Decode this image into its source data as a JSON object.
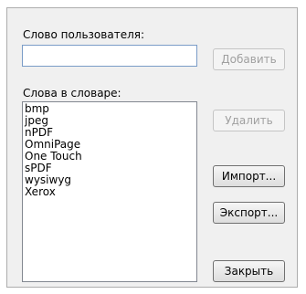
{
  "user_word": {
    "label": "Слово пользователя:",
    "value": ""
  },
  "dictionary": {
    "label": "Слова в словаре:",
    "words": [
      "bmp",
      "jpeg",
      "nPDF",
      "OmniPage",
      "One Touch",
      "sPDF",
      "wysiwyg",
      "Xerox"
    ]
  },
  "buttons": {
    "add": "Добавить",
    "remove": "Удалить",
    "import": "Импорт...",
    "export": "Экспорт...",
    "close": "Закрыть"
  }
}
